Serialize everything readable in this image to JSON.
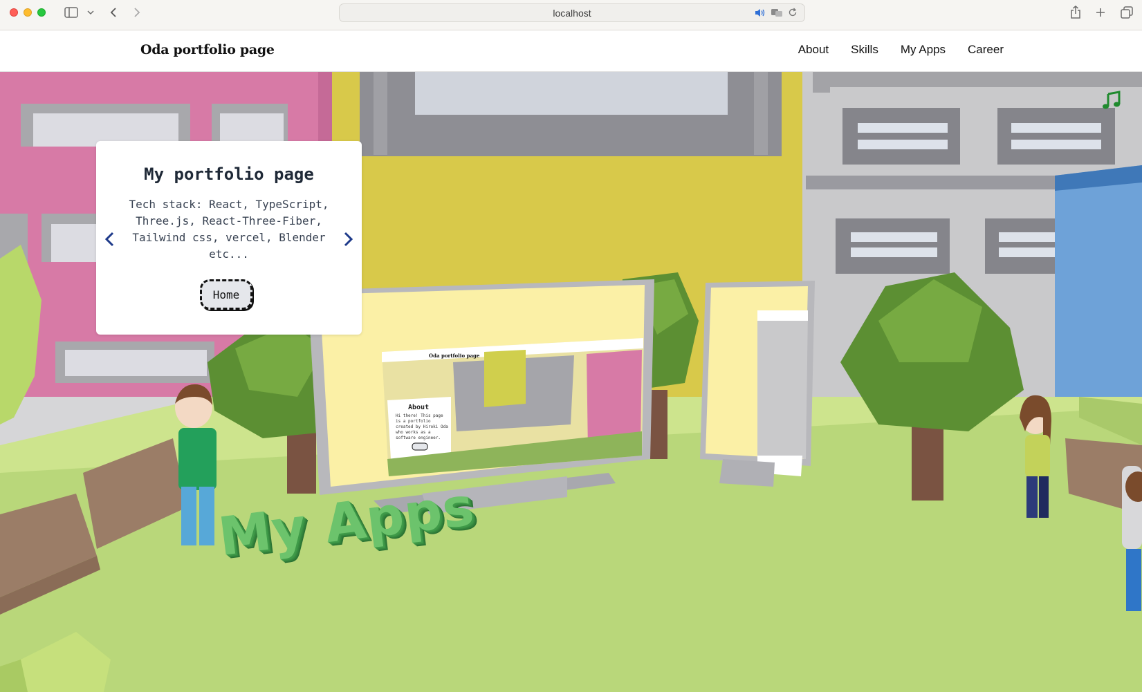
{
  "browser": {
    "url": "localhost"
  },
  "navbar": {
    "brand": "Oda portfolio page",
    "links": [
      {
        "label": "About"
      },
      {
        "label": "Skills"
      },
      {
        "label": "My Apps"
      },
      {
        "label": "Career"
      }
    ]
  },
  "card": {
    "title": "My portfolio page",
    "text": "Tech stack: React, TypeScript, Three.js, React-Three-Fiber, Tailwind css, vercel, Blender etc...",
    "button": "Home"
  },
  "scene": {
    "heading_3d": "My Apps",
    "music_icon": "music-note-icon",
    "mini_screen": {
      "brand": "Oda portfolio page",
      "about_title": "About",
      "about_text": "Hi there! This page is a portfolio created by Hiroki Oda who works as a software engineer."
    },
    "colors": {
      "ground": "#b9d77a",
      "pink_building": "#d77aa6",
      "yellow_building": "#d8c94a",
      "grey_building": "#c9c9cb",
      "music_icon": "#1f8a2e"
    }
  }
}
